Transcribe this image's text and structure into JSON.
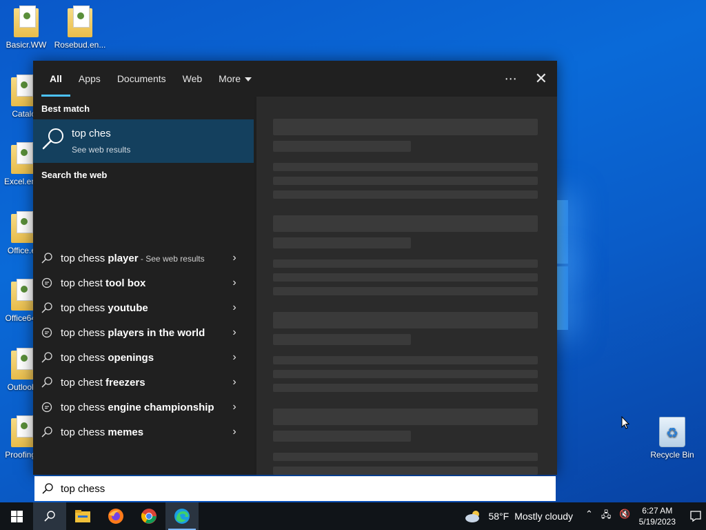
{
  "desktop": {
    "icons": [
      {
        "label": "Basicr.WW"
      },
      {
        "label": "Rosebud.en..."
      },
      {
        "label": "Catalo"
      },
      {
        "label": "Excel.en"
      },
      {
        "label": "Office.e"
      },
      {
        "label": "Office64"
      },
      {
        "label": "Outlook"
      },
      {
        "label": "Proofing"
      },
      {
        "label": "Recycle Bin"
      }
    ]
  },
  "search_panel": {
    "tabs": [
      {
        "label": "All",
        "active": true
      },
      {
        "label": "Apps"
      },
      {
        "label": "Documents"
      },
      {
        "label": "Web"
      },
      {
        "label": "More"
      }
    ],
    "more_icon": "ellipsis-icon",
    "close_icon": "close-icon",
    "best_match": {
      "section_title": "Best match",
      "title": "top ches",
      "subtitle": "See web results"
    },
    "web": {
      "section_title": "Search the web",
      "suggestions": [
        {
          "prefix": "top chess",
          "bold": " player",
          "extra": " - See web results",
          "icon": "search-icon"
        },
        {
          "prefix": "top chest",
          "bold": " tool box",
          "extra": "",
          "icon": "chat-icon"
        },
        {
          "prefix": "top chess",
          "bold": " youtube",
          "extra": "",
          "icon": "search-icon"
        },
        {
          "prefix": "top chess",
          "bold": " players in the world",
          "extra": "",
          "icon": "chat-icon"
        },
        {
          "prefix": "top chess",
          "bold": " openings",
          "extra": "",
          "icon": "search-icon"
        },
        {
          "prefix": "top chest",
          "bold": " freezers",
          "extra": "",
          "icon": "search-icon"
        },
        {
          "prefix": "top chess",
          "bold": " engine championship",
          "extra": "",
          "icon": "chat-icon"
        },
        {
          "prefix": "top chess",
          "bold": " memes",
          "extra": "",
          "icon": "search-icon"
        }
      ]
    },
    "search_box": {
      "value": "top chess"
    }
  },
  "taskbar": {
    "apps": [
      "start-icon",
      "search-icon",
      "file-explorer-icon",
      "firefox-icon",
      "chrome-icon",
      "edge-icon"
    ],
    "weather": {
      "temp": "58°F",
      "condition": "Mostly cloudy"
    },
    "clock": {
      "time": "6:27 AM",
      "date": "5/19/2023"
    }
  }
}
